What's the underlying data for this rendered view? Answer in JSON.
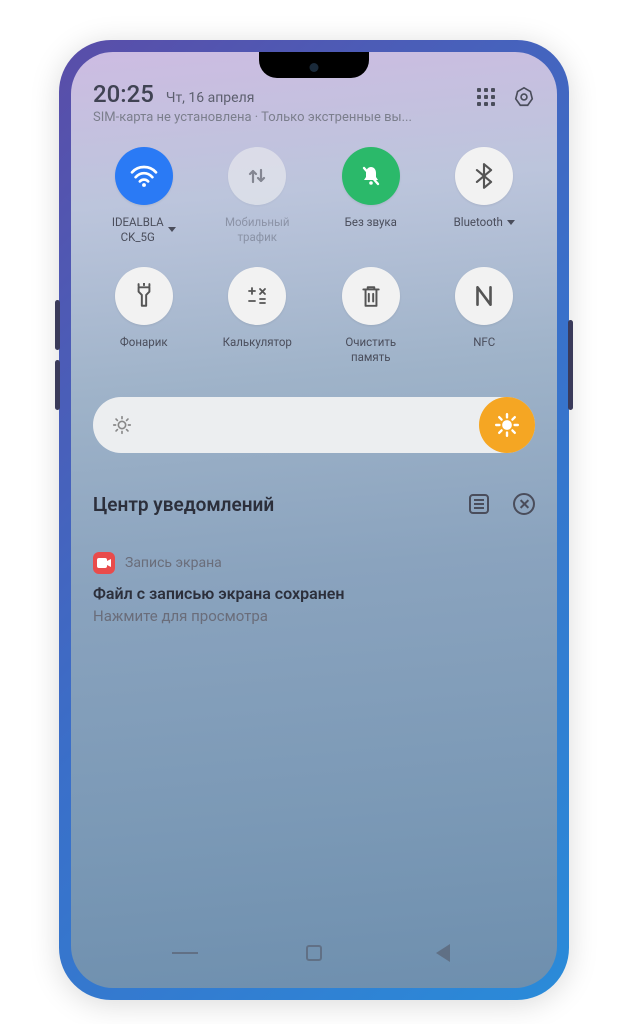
{
  "status": {
    "time": "20:25",
    "date": "Чт, 16 апреля",
    "sim_message": "SIM-карта не установлена · Только экстренные вы..."
  },
  "qs": {
    "row1": [
      {
        "label": "IDEALBLA\nCK_5G",
        "icon": "wifi",
        "state": "active-blue",
        "arrow": true
      },
      {
        "label": "Мобильный\nтрафик",
        "icon": "data",
        "state": "dim",
        "dim_label": true
      },
      {
        "label": "Без звука",
        "icon": "mute",
        "state": "active-green"
      },
      {
        "label": "Bluetooth",
        "icon": "bluetooth",
        "state": "off",
        "arrow": true
      }
    ],
    "row2": [
      {
        "label": "Фонарик",
        "icon": "flashlight",
        "state": "off"
      },
      {
        "label": "Калькулятор",
        "icon": "calculator",
        "state": "off"
      },
      {
        "label": "Очистить\nпамять",
        "icon": "trash",
        "state": "off"
      },
      {
        "label": "NFC",
        "icon": "nfc",
        "state": "off"
      }
    ]
  },
  "notification_center": {
    "title": "Центр уведомлений"
  },
  "notification": {
    "app": "Запись экрана",
    "title": "Файл с записью экрана сохранен",
    "body": "Нажмите для просмотра"
  }
}
